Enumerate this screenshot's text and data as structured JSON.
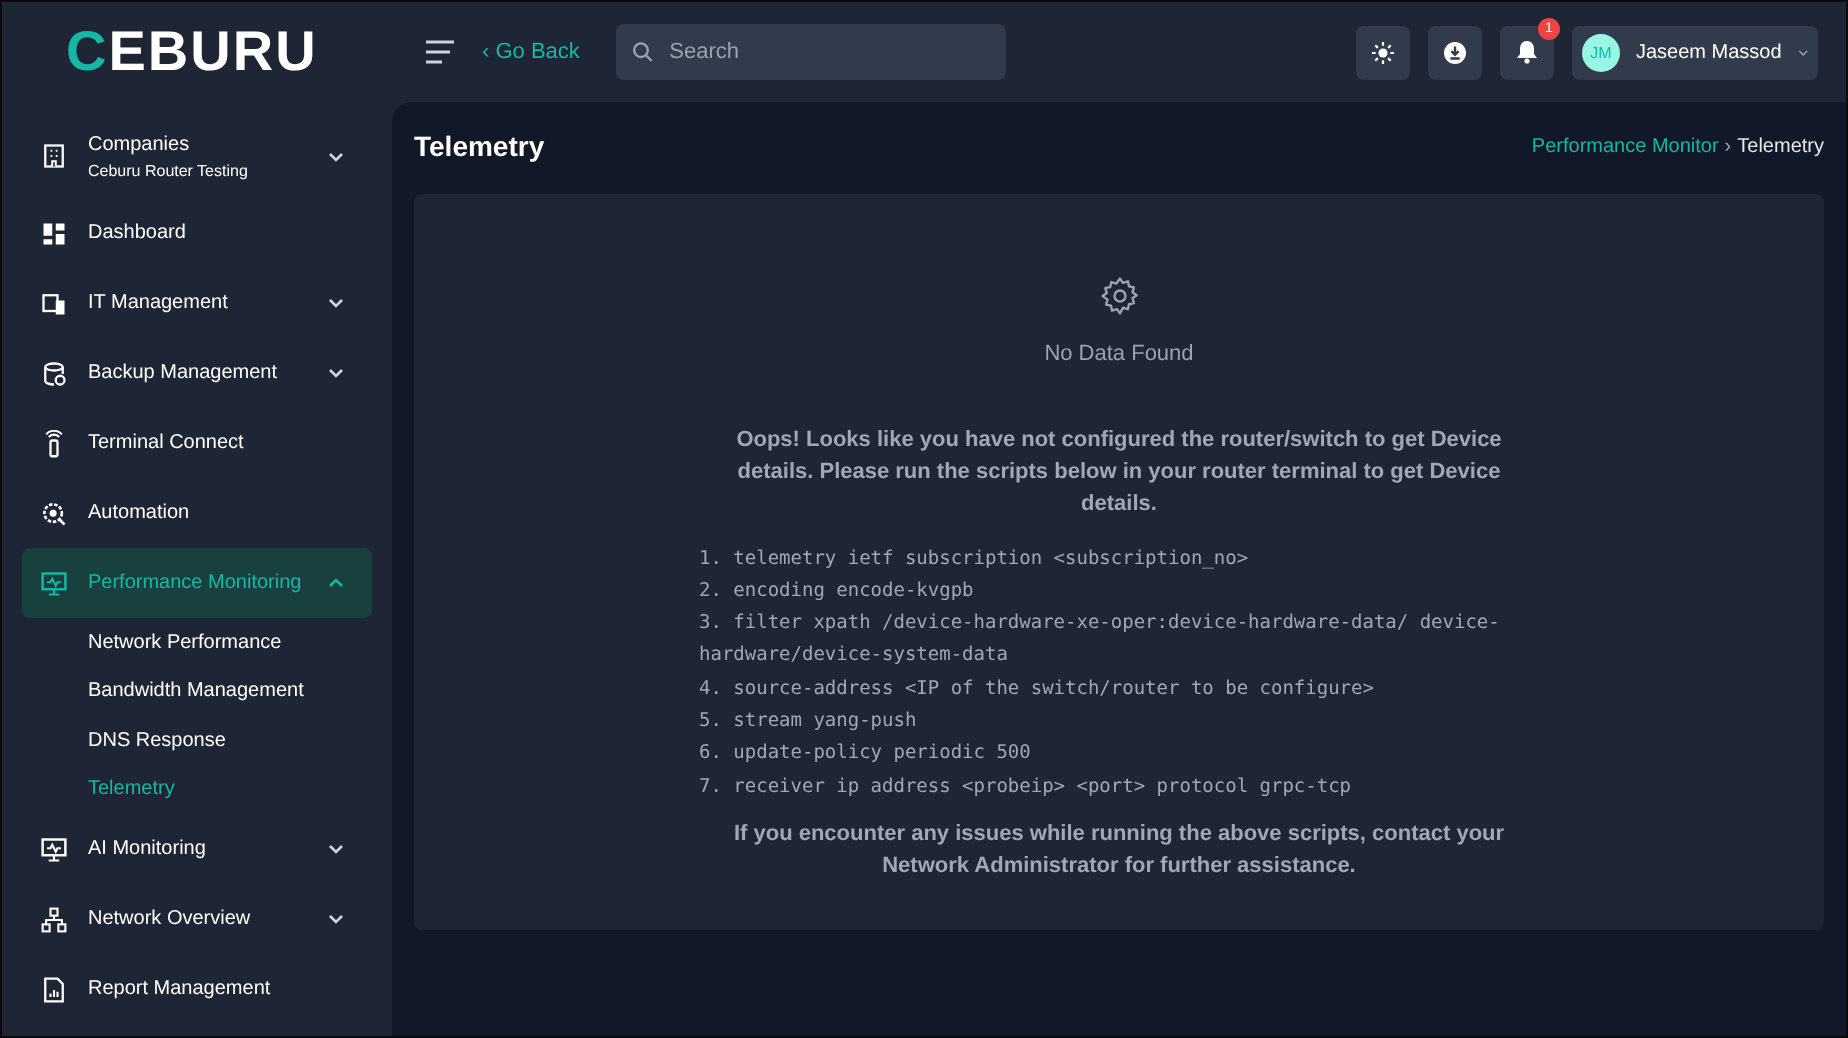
{
  "header": {
    "logo": "CEBURU",
    "back_link": "‹ Go Back",
    "search": {
      "placeholder": "Search"
    },
    "notifications": {
      "badge": "1"
    },
    "user": {
      "initials": "JM",
      "name": "Jaseem Massod"
    }
  },
  "sidebar": {
    "items": [
      {
        "label": "Companies",
        "sublabel": "Ceburu Router Testing",
        "expanded": false,
        "selected": false
      },
      {
        "label": "Dashboard",
        "selected": false
      },
      {
        "label": "IT Management",
        "expanded": false,
        "selected": false
      },
      {
        "label": "Backup Management",
        "expanded": false,
        "selected": false
      },
      {
        "label": "Terminal Connect",
        "selected": false
      },
      {
        "label": "Automation",
        "selected": false
      },
      {
        "label": "Performance Monitoring",
        "expanded": true,
        "selected": true,
        "children": [
          {
            "label": "Network Performance",
            "selected": false
          },
          {
            "label": "Bandwidth Management",
            "selected": false
          },
          {
            "label": "DNS Response",
            "selected": false
          },
          {
            "label": "Telemetry",
            "selected": true
          }
        ]
      },
      {
        "label": "AI Monitoring",
        "expanded": false,
        "selected": false
      },
      {
        "label": "Network Overview",
        "expanded": false,
        "selected": false
      },
      {
        "label": "Report Management",
        "selected": false
      }
    ]
  },
  "page": {
    "title": "Telemetry",
    "breadcrumb": [
      "Performance Monitor",
      "Telemetry"
    ],
    "breadcrumb_separator": "›",
    "empty_state": {
      "title": "No Data Found",
      "message": "Oops! Looks like you have not configured the router/switch to get Device details. Please run the scripts below in your router terminal to get Device details.",
      "script_lines": [
        "1. telemetry ietf subscription <subscription_no>",
        "2. encoding encode-kvgpb",
        "3. filter xpath /device-hardware-xe-oper:device-hardware-data/ device-hardware/device-system-data",
        "4. source-address <IP of the switch/router to be configure>",
        "5. stream yang-push",
        "6. update-policy periodic 500",
        "7. receiver ip address <probeip> <port> protocol grpc-tcp"
      ],
      "footer": "If you encounter any issues while running the above scripts, contact your Network Administrator for further assistance."
    }
  }
}
